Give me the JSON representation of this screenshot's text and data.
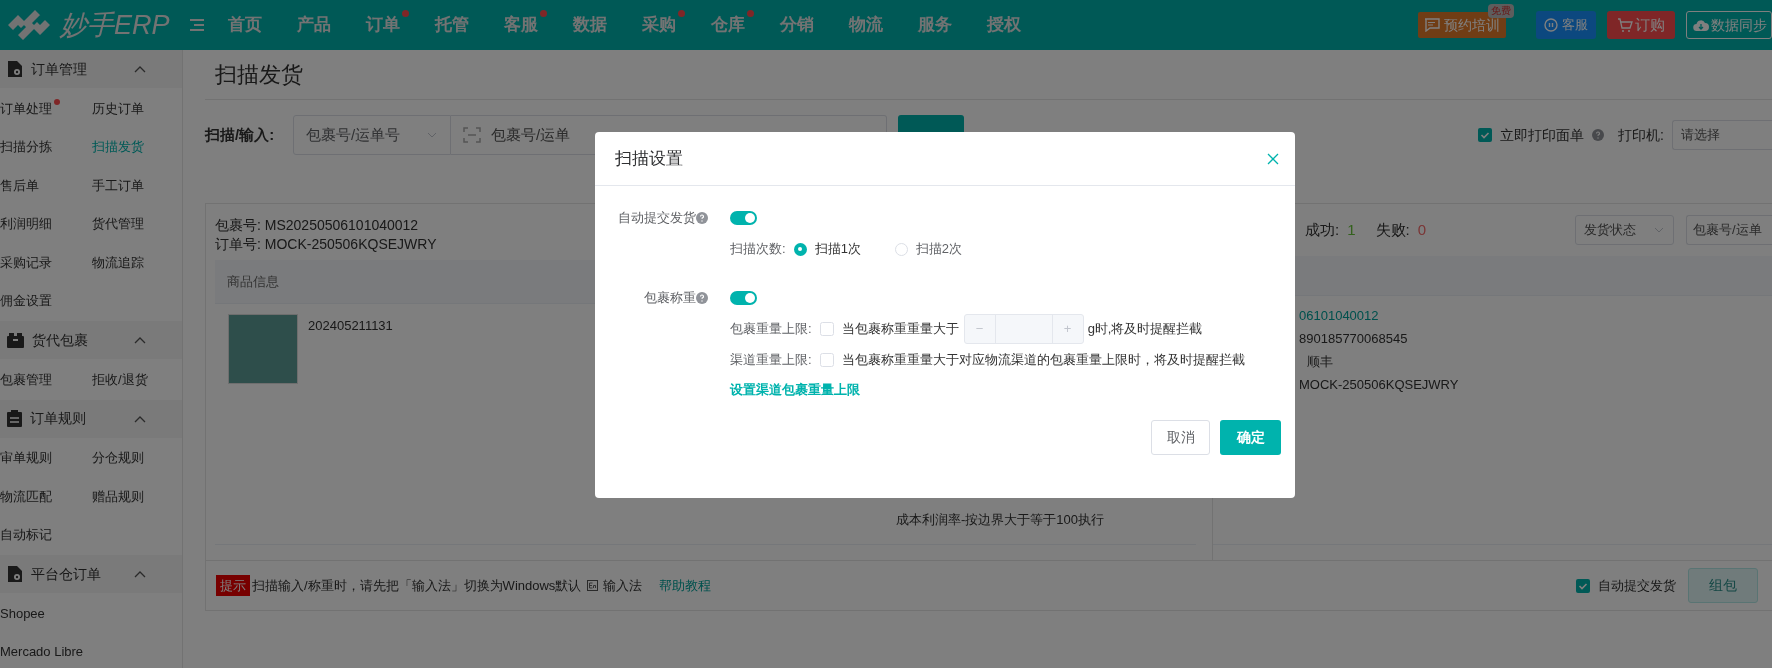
{
  "top_nav": {
    "logo": "妙手ERP",
    "menu": [
      {
        "label": "首页",
        "dot": false
      },
      {
        "label": "产品",
        "dot": false
      },
      {
        "label": "订单",
        "dot": true
      },
      {
        "label": "托管",
        "dot": false
      },
      {
        "label": "客服",
        "dot": true
      },
      {
        "label": "数据",
        "dot": false
      },
      {
        "label": "采购",
        "dot": true
      },
      {
        "label": "仓库",
        "dot": true
      },
      {
        "label": "分销",
        "dot": false
      },
      {
        "label": "物流",
        "dot": false
      },
      {
        "label": "服务",
        "dot": false
      },
      {
        "label": "授权",
        "dot": false
      }
    ],
    "training": {
      "label": "预约培训",
      "badge": "免费"
    },
    "service": "客服",
    "purchase": "订购",
    "sync": "数据同步"
  },
  "sidebar": {
    "groups": [
      {
        "title": "订单管理",
        "expanded": true,
        "items": [
          {
            "label": "订单处理",
            "selected": false,
            "dot": true
          },
          {
            "label": "历史订单",
            "selected": false,
            "dot": false
          },
          {
            "label": "扫描分拣",
            "selected": false,
            "dot": false
          },
          {
            "label": "扫描发货",
            "selected": true,
            "dot": false
          },
          {
            "label": "售后单",
            "selected": false,
            "dot": false
          },
          {
            "label": "手工订单",
            "selected": false,
            "dot": false
          },
          {
            "label": "利润明细",
            "selected": false,
            "dot": false
          },
          {
            "label": "货代管理",
            "selected": false,
            "dot": false
          },
          {
            "label": "采购记录",
            "selected": false,
            "dot": false
          },
          {
            "label": "物流追踪",
            "selected": false,
            "dot": false
          },
          {
            "label": "佣金设置",
            "selected": false,
            "dot": false
          }
        ]
      },
      {
        "title": "货代包裹",
        "expanded": true,
        "items": [
          {
            "label": "包裹管理",
            "selected": false,
            "dot": false
          },
          {
            "label": "拒收/退货",
            "selected": false,
            "dot": false
          }
        ]
      },
      {
        "title": "订单规则",
        "expanded": true,
        "items": [
          {
            "label": "审单规则",
            "selected": false,
            "dot": false
          },
          {
            "label": "分仓规则",
            "selected": false,
            "dot": false
          },
          {
            "label": "物流匹配",
            "selected": false,
            "dot": false
          },
          {
            "label": "赠品规则",
            "selected": false,
            "dot": false
          },
          {
            "label": "自动标记",
            "selected": false,
            "dot": false
          }
        ]
      },
      {
        "title": "平台仓订单",
        "expanded": true,
        "items": [
          {
            "label": "Shopee",
            "selected": false,
            "dot": false
          },
          {
            "label": "Mercado Libre",
            "selected": false,
            "dot": false
          }
        ]
      }
    ]
  },
  "page_title": "扫描发货",
  "scan_bar": {
    "label": "扫描/输入:",
    "type_select": "包裹号/运单号",
    "input_placeholder": "包裹号/运单",
    "print_now": {
      "label": "立即打印面单",
      "checked": true
    },
    "printer_label": "打印机:",
    "printer_placeholder": "请选择"
  },
  "package": {
    "package_no_label": "包裹号:",
    "package_no": "MS20250506101040012",
    "order_no_label": "订单号:",
    "order_no": "MOCK-250506KQSEJWRY",
    "table_header": "商品信息",
    "product_sku": "202405211131",
    "note": "成本利润率-按边界大于等于100执行"
  },
  "hint": {
    "tag": "提示",
    "text": "扫描输入/称重时，请先把「输入法」切换为Windows默认",
    "ime": "输入法",
    "link": "帮助教程"
  },
  "results": {
    "success_label": "成功:",
    "success": "1",
    "fail_label": "失败:",
    "fail": "0",
    "status_placeholder": "发货状态",
    "search_placeholder": "包裹号/运单",
    "lines": [
      "06101040012",
      "890185770068545",
      "顺丰",
      "MOCK-250506KQSEJWRY"
    ],
    "auto_submit": {
      "label": "自动提交发货",
      "checked": true
    },
    "pack_button": {
      "label": "组包",
      "disabled": true
    }
  },
  "modal": {
    "title": "扫描设置",
    "auto_submit": {
      "label": "自动提交发货",
      "on": true
    },
    "scan_count_label": "扫描次数:",
    "scan_options": [
      {
        "label": "扫描1次",
        "selected": true
      },
      {
        "label": "扫描2次",
        "selected": false
      }
    ],
    "weighing": {
      "label": "包裹称重",
      "on": true
    },
    "weight_limit": {
      "label": "包裹重量上限:",
      "checked": false,
      "text_before": "当包裹称重重量大于",
      "minus": "−",
      "plus": "+",
      "text_after": "g时,将及时提醒拦截"
    },
    "channel_limit": {
      "label": "渠道重量上限:",
      "checked": false,
      "text": "当包裹称重重量大于对应物流渠道的包裹重量上限时，将及时提醒拦截"
    },
    "channel_link": "设置渠道包裹重量上限",
    "cancel": "取消",
    "confirm": "确定"
  }
}
